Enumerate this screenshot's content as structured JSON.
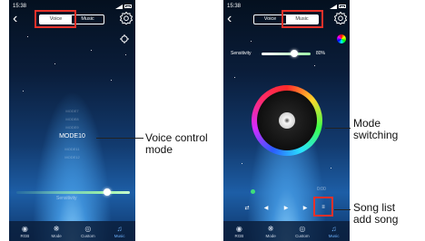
{
  "left_screen": {
    "status_time": "15:38",
    "tabs": {
      "voice": "Voice",
      "music": "Music"
    },
    "modes_above": [
      "MODE7",
      "MODE8",
      "MODE9"
    ],
    "mode_current": "MODE10",
    "modes_below": [
      "MODE11",
      "MODE12"
    ],
    "sensitivity_label": "Sensitivity",
    "sensitivity_level": 0.8
  },
  "right_screen": {
    "status_time": "15:38",
    "tabs": {
      "voice": "Voice",
      "music": "Music"
    },
    "sensitivity_label": "Sensitivity",
    "sensitivity_value": "80%",
    "time_label": "0:00"
  },
  "tabbar": {
    "items": [
      {
        "label": "RGB",
        "icon": "bulb-icon"
      },
      {
        "label": "Mode",
        "icon": "mode-icon"
      },
      {
        "label": "Custom",
        "icon": "custom-icon"
      },
      {
        "label": "Music",
        "icon": "music-note-icon"
      }
    ]
  },
  "callouts": {
    "voice_control": [
      "Voice control",
      "mode"
    ],
    "mode_switching": [
      "Mode",
      "switching"
    ],
    "song_list": [
      "Song list",
      "add song"
    ]
  },
  "colors": {
    "highlight": "#e8312a",
    "accent": "#6fb4ff",
    "slider": "#9ff5a8"
  }
}
